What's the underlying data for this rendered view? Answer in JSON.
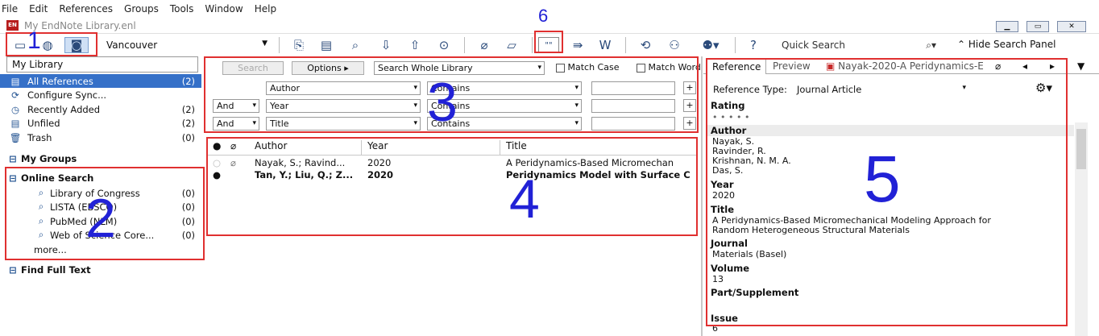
{
  "menu": [
    "File",
    "Edit",
    "References",
    "Groups",
    "Tools",
    "Window",
    "Help"
  ],
  "window": {
    "title": "My EndNote Library.enl",
    "app_icon": "EN"
  },
  "toolbar": {
    "style": "Vancouver",
    "quick_search": "Quick Search",
    "hide_panel": "Hide Search Panel",
    "quote_btn": "\"\""
  },
  "library": {
    "search_box": "My Library",
    "groups": [
      {
        "label": "All References",
        "count": "(2)"
      },
      {
        "label": "Configure Sync...",
        "count": ""
      },
      {
        "label": "Recently Added",
        "count": "(2)"
      },
      {
        "label": "Unfiled",
        "count": "(2)"
      },
      {
        "label": "Trash",
        "count": "(0)"
      }
    ],
    "my_groups": "My Groups",
    "online_search": "Online Search",
    "online": [
      {
        "label": "Library of Congress",
        "count": "(0)"
      },
      {
        "label": "LISTA (EBSCO)",
        "count": "(0)"
      },
      {
        "label": "PubMed (NLM)",
        "count": "(0)"
      },
      {
        "label": "Web of Science Core...",
        "count": "(0)"
      }
    ],
    "more": "more...",
    "find_full_text": "Find Full Text"
  },
  "search": {
    "search_btn": "Search",
    "options_btn": "Options",
    "scope": "Search Whole Library",
    "match_case": "Match Case",
    "match_words": "Match Words",
    "rows": [
      {
        "bool": "",
        "field": "Author",
        "op": "Contains"
      },
      {
        "bool": "And",
        "field": "Year",
        "op": "Contains"
      },
      {
        "bool": "And",
        "field": "Title",
        "op": "Contains"
      }
    ]
  },
  "list": {
    "columns": [
      "Author",
      "Year",
      "Title"
    ],
    "rows": [
      {
        "author": "Nayak, S.; Ravind...",
        "year": "2020",
        "title": "A Peridynamics-Based Micromechan",
        "bold": false
      },
      {
        "author": "Tan, Y.; Liu, Q.; Z...",
        "year": "2020",
        "title": "Peridynamics Model with Surface C",
        "bold": true
      }
    ]
  },
  "reference": {
    "tabs": [
      "Reference",
      "Preview",
      "Nayak-2020-A Peridynamics-E"
    ],
    "type_label": "Reference Type:",
    "type_value": "Journal Article",
    "rating_label": "Rating",
    "rating_dots": "•  •  •  •  •",
    "author_label": "Author",
    "authors": [
      "Nayak, S.",
      "Ravinder, R.",
      "Krishnan, N. M. A.",
      "Das, S."
    ],
    "year_label": "Year",
    "year": "2020",
    "title_label": "Title",
    "title_lines": [
      "A Peridynamics-Based Micromechanical Modeling Approach for",
      "Random Heterogeneous Structural Materials"
    ],
    "journal_label": "Journal",
    "journal": "Materials (Basel)",
    "volume_label": "Volume",
    "volume": "13",
    "part_label": "Part/Supplement",
    "issue_label": "Issue",
    "issue": "6"
  },
  "annotations": [
    "1",
    "2",
    "3",
    "4",
    "5",
    "6"
  ]
}
